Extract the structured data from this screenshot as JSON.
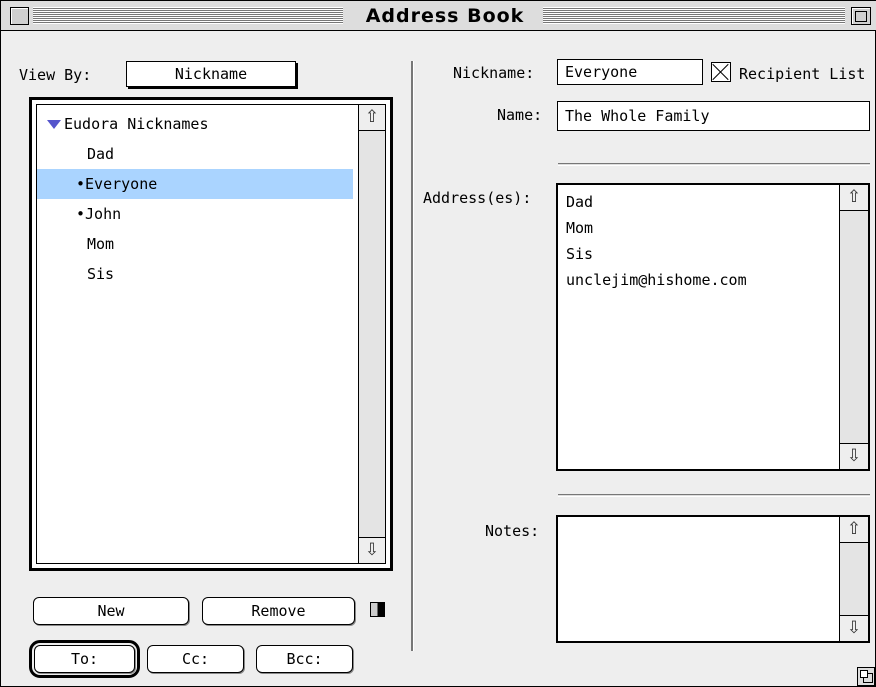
{
  "window": {
    "title": "Address Book"
  },
  "left": {
    "view_by_label": "View By:",
    "view_by_value": "Nickname",
    "list": {
      "group_label": "Eudora Nicknames",
      "items": [
        {
          "label": "Dad",
          "prefix": ""
        },
        {
          "label": "Everyone",
          "prefix": "•",
          "selected": true
        },
        {
          "label": "John",
          "prefix": "•"
        },
        {
          "label": "Mom",
          "prefix": ""
        },
        {
          "label": "Sis",
          "prefix": ""
        }
      ]
    },
    "buttons": {
      "new": "New",
      "remove": "Remove",
      "to": "To:",
      "cc": "Cc:",
      "bcc": "Bcc:"
    }
  },
  "right": {
    "nickname_label": "Nickname:",
    "nickname_value": "Everyone",
    "recipient_list_label": "Recipient List",
    "recipient_list_checked": true,
    "name_label": "Name:",
    "name_value": "The Whole Family",
    "addresses_label": "Address(es):",
    "addresses": [
      "Dad",
      "Mom",
      "Sis",
      "unclejim@hishome.com"
    ],
    "notes_label": "Notes:",
    "notes_value": ""
  },
  "colors": {
    "selection": "#aad4ff",
    "disclosure_triangle": "#5555cc"
  }
}
